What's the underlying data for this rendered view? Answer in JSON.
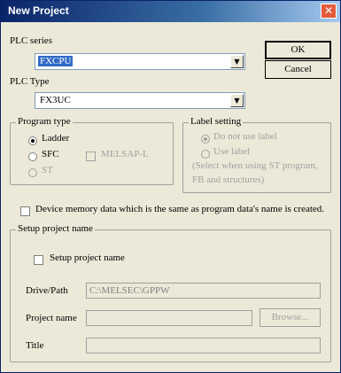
{
  "window": {
    "title": "New Project",
    "close_glyph": "✕"
  },
  "plc_series": {
    "label": "PLC series",
    "value": "FXCPU"
  },
  "plc_type": {
    "label": "PLC Type",
    "value": "FX3UC"
  },
  "buttons": {
    "ok": "OK",
    "cancel": "Cancel",
    "browse": "Browse..."
  },
  "program_type": {
    "title": "Program type",
    "ladder": "Ladder",
    "sfc": "SFC",
    "melsap": "MELSAP-L",
    "st": "ST"
  },
  "label_setting": {
    "title": "Label setting",
    "do_not_use": "Do not use label",
    "use_label": "Use label",
    "note_line1": "(Select when using ST program,",
    "note_line2": "FB and structures)"
  },
  "device_memory": {
    "label": "Device memory data which is the same as program data's name is created."
  },
  "setup": {
    "title": "Setup project name",
    "checkbox_label": "Setup project name",
    "drive_path_label": "Drive/Path",
    "drive_path_value": "C:\\MELSEC\\GPPW",
    "project_name_label": "Project name",
    "title_label": "Title"
  }
}
